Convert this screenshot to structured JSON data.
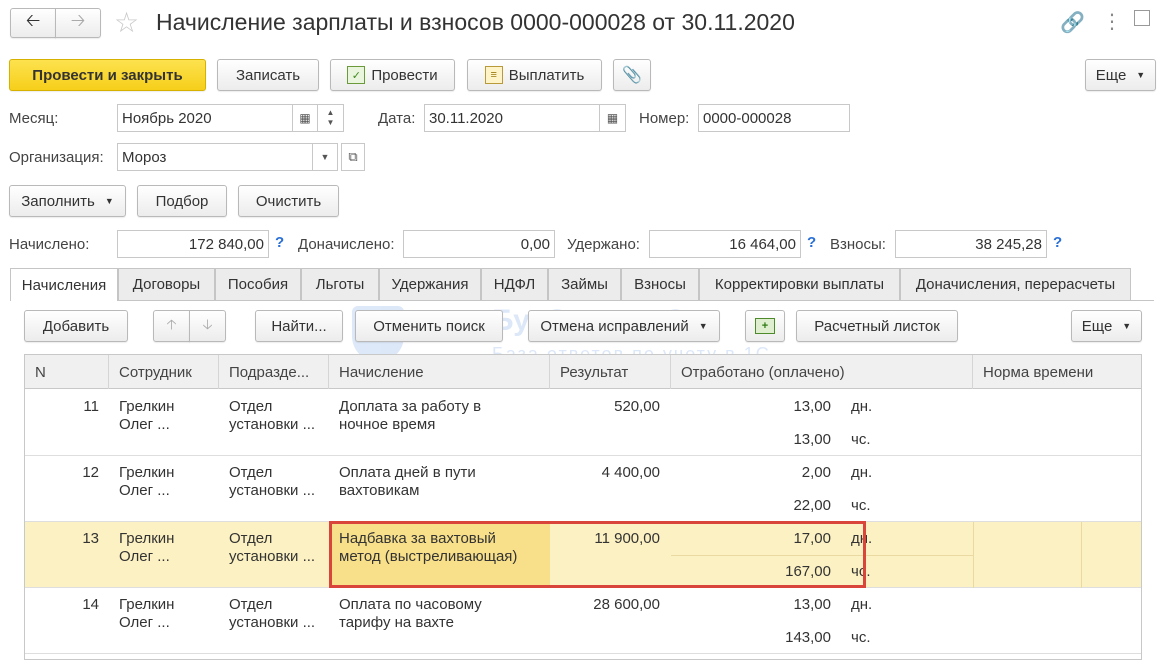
{
  "window": {
    "title": "Начисление зарплаты и взносов 0000-000028 от 30.11.2020"
  },
  "toolbar": {
    "post_close": "Провести и закрыть",
    "save": "Записать",
    "post": "Провести",
    "pay": "Выплатить",
    "more": "Еще"
  },
  "header": {
    "month_label": "Месяц:",
    "month_value": "Ноябрь 2020",
    "date_label": "Дата:",
    "date_value": "30.11.2020",
    "number_label": "Номер:",
    "number_value": "0000-000028",
    "org_label": "Организация:",
    "org_value": "Мороз"
  },
  "actions": {
    "fill": "Заполнить",
    "select": "Подбор",
    "clear": "Очистить"
  },
  "totals": {
    "accrued_label": "Начислено:",
    "accrued_value": "172 840,00",
    "extra_label": "Доначислено:",
    "extra_value": "0,00",
    "withheld_label": "Удержано:",
    "withheld_value": "16 464,00",
    "contrib_label": "Взносы:",
    "contrib_value": "38 245,28",
    "help": "?"
  },
  "tabs": [
    {
      "label": "Начисления"
    },
    {
      "label": "Договоры"
    },
    {
      "label": "Пособия"
    },
    {
      "label": "Льготы"
    },
    {
      "label": "Удержания"
    },
    {
      "label": "НДФЛ"
    },
    {
      "label": "Займы"
    },
    {
      "label": "Взносы"
    },
    {
      "label": "Корректировки выплаты"
    },
    {
      "label": "Доначисления, перерасчеты"
    }
  ],
  "tab_toolbar": {
    "add": "Добавить",
    "find": "Найти...",
    "cancel_search": "Отменить поиск",
    "cancel_fixes": "Отмена исправлений",
    "payslip": "Расчетный листок",
    "more": "Еще"
  },
  "table": {
    "columns": [
      "N",
      "Сотрудник",
      "Подразде...",
      "Начисление",
      "Результат",
      "Отработано (оплачено)",
      "Норма времени"
    ],
    "rows": [
      {
        "n": "11",
        "employee_1": "Грелкин",
        "employee_2": "Олег ...",
        "dept_1": "Отдел",
        "dept_2": "установки ...",
        "accrual_1": "Доплата за работу в",
        "accrual_2": "ночное время",
        "result": "520,00",
        "days": "13,00",
        "days_unit": "дн.",
        "hours": "13,00",
        "hours_unit": "чс."
      },
      {
        "n": "12",
        "employee_1": "Грелкин",
        "employee_2": "Олег ...",
        "dept_1": "Отдел",
        "dept_2": "установки ...",
        "accrual_1": "Оплата дней в пути",
        "accrual_2": "вахтовикам",
        "result": "4 400,00",
        "days": "2,00",
        "days_unit": "дн.",
        "hours": "22,00",
        "hours_unit": "чс."
      },
      {
        "n": "13",
        "employee_1": "Грелкин",
        "employee_2": "Олег ...",
        "dept_1": "Отдел",
        "dept_2": "установки ...",
        "accrual_1": "Надбавка за вахтовый",
        "accrual_2": "метод (выстреливающая)",
        "result": "11 900,00",
        "days": "17,00",
        "days_unit": "дн.",
        "hours": "167,00",
        "hours_unit": "чс."
      },
      {
        "n": "14",
        "employee_1": "Грелкин",
        "employee_2": "Олег ...",
        "dept_1": "Отдел",
        "dept_2": "установки ...",
        "accrual_1": "Оплата по часовому",
        "accrual_2": "тарифу на вахте",
        "result": "28 600,00",
        "days": "13,00",
        "days_unit": "дн.",
        "hours": "143,00",
        "hours_unit": "чс."
      }
    ]
  },
  "watermark": {
    "line1": "БухЭксперт8",
    "line2": "База ответов по учету в 1С"
  },
  "colors": {
    "primary_button": "#f6cf1a",
    "selected_row": "#fcf1c2",
    "highlight_border": "#d9453b",
    "help_mark": "#2a6fd6"
  }
}
